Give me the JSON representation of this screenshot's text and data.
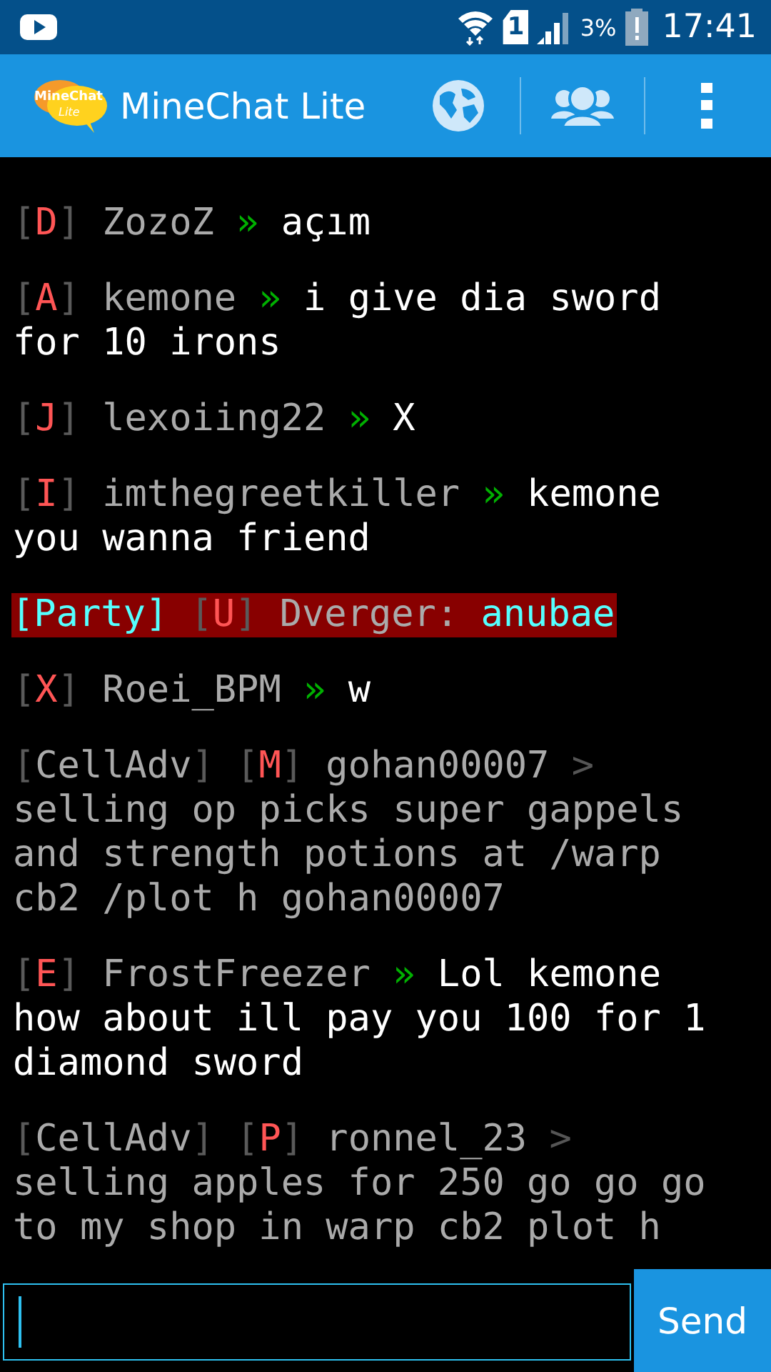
{
  "status_bar": {
    "sim_slot": "1",
    "battery": "3%",
    "time": "17:41"
  },
  "app_bar": {
    "logo": {
      "line1": "MineChat",
      "line2": "Lite"
    },
    "title": "MineChat Lite"
  },
  "messages": [
    {
      "highlighted": false,
      "segments": [
        {
          "kind": "bracket",
          "text": "["
        },
        {
          "kind": "rank",
          "text": "D"
        },
        {
          "kind": "bracket",
          "text": "]"
        },
        {
          "kind": "name",
          "text": " ZozoZ "
        },
        {
          "kind": "arrow",
          "text": "»"
        },
        {
          "kind": "body",
          "text": " açım"
        }
      ]
    },
    {
      "highlighted": false,
      "segments": [
        {
          "kind": "bracket",
          "text": "["
        },
        {
          "kind": "rank",
          "text": "A"
        },
        {
          "kind": "bracket",
          "text": "]"
        },
        {
          "kind": "name",
          "text": " kemone "
        },
        {
          "kind": "arrow",
          "text": "»"
        },
        {
          "kind": "body",
          "text": " i give dia sword for 10 irons"
        }
      ]
    },
    {
      "highlighted": false,
      "segments": [
        {
          "kind": "bracket",
          "text": "["
        },
        {
          "kind": "rank",
          "text": "J"
        },
        {
          "kind": "bracket",
          "text": "]"
        },
        {
          "kind": "name",
          "text": " lexoiing22 "
        },
        {
          "kind": "arrow",
          "text": "»"
        },
        {
          "kind": "body",
          "text": " X"
        }
      ]
    },
    {
      "highlighted": false,
      "segments": [
        {
          "kind": "bracket",
          "text": "["
        },
        {
          "kind": "rank",
          "text": "I"
        },
        {
          "kind": "bracket",
          "text": "]"
        },
        {
          "kind": "name",
          "text": " imthegreetkiller "
        },
        {
          "kind": "arrow",
          "text": "»"
        },
        {
          "kind": "body",
          "text": " kemone you wanna friend"
        }
      ]
    },
    {
      "highlighted": true,
      "segments": [
        {
          "kind": "party",
          "text": "[Party] "
        },
        {
          "kind": "bracket",
          "text": "["
        },
        {
          "kind": "rank",
          "text": "U"
        },
        {
          "kind": "bracket",
          "text": "]"
        },
        {
          "kind": "name",
          "text": " Dverger: "
        },
        {
          "kind": "party",
          "text": "anubae"
        }
      ]
    },
    {
      "highlighted": false,
      "segments": [
        {
          "kind": "bracket",
          "text": "["
        },
        {
          "kind": "rank",
          "text": "X"
        },
        {
          "kind": "bracket",
          "text": "]"
        },
        {
          "kind": "name",
          "text": " Roei_BPM "
        },
        {
          "kind": "arrow",
          "text": "»"
        },
        {
          "kind": "body",
          "text": " w"
        }
      ]
    },
    {
      "highlighted": false,
      "segments": [
        {
          "kind": "bracket",
          "text": "["
        },
        {
          "kind": "name",
          "text": "CellAdv"
        },
        {
          "kind": "bracket",
          "text": "] ["
        },
        {
          "kind": "rank",
          "text": "M"
        },
        {
          "kind": "bracket",
          "text": "]"
        },
        {
          "kind": "name",
          "text": " gohan00007 "
        },
        {
          "kind": "pointer",
          "text": ">"
        },
        {
          "kind": "name",
          "text": " selling op picks super gappels and strength potions at /warp cb2 /plot h gohan00007"
        }
      ]
    },
    {
      "highlighted": false,
      "segments": [
        {
          "kind": "bracket",
          "text": "["
        },
        {
          "kind": "rank",
          "text": "E"
        },
        {
          "kind": "bracket",
          "text": "]"
        },
        {
          "kind": "name",
          "text": " FrostFreezer "
        },
        {
          "kind": "arrow",
          "text": "»"
        },
        {
          "kind": "body",
          "text": " Lol kemone how about ill pay you 100 for 1 diamond sword"
        }
      ]
    },
    {
      "highlighted": false,
      "segments": [
        {
          "kind": "bracket",
          "text": "["
        },
        {
          "kind": "name",
          "text": "CellAdv"
        },
        {
          "kind": "bracket",
          "text": "] ["
        },
        {
          "kind": "rank",
          "text": "P"
        },
        {
          "kind": "bracket",
          "text": "]"
        },
        {
          "kind": "name",
          "text": " ronnel_23 "
        },
        {
          "kind": "pointer",
          "text": ">"
        },
        {
          "kind": "name",
          "text": " selling apples for 250 go go go to my shop in warp cb2 plot h"
        }
      ]
    }
  ],
  "composer": {
    "send": "Send"
  }
}
